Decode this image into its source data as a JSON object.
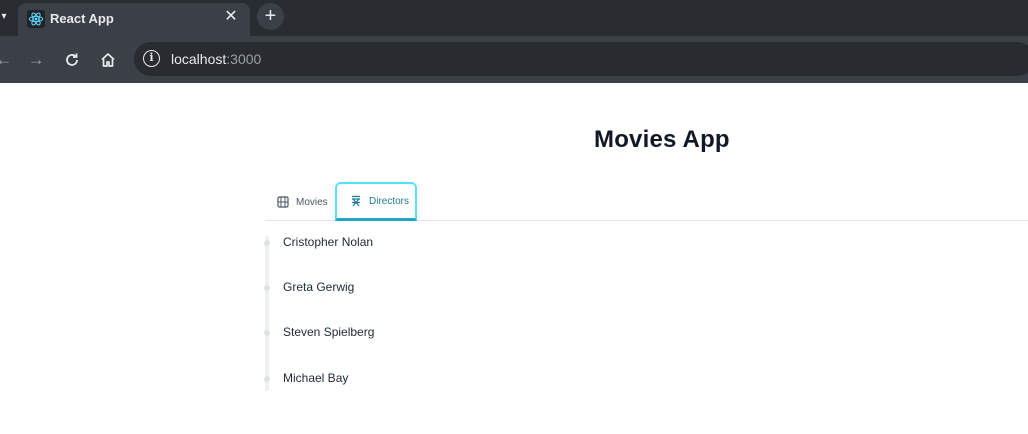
{
  "browser": {
    "tab_title": "React App",
    "url_host": "localhost",
    "url_port": ":3000"
  },
  "app": {
    "title": "Movies App",
    "tabs": [
      {
        "label": "Movies",
        "icon": "film-icon",
        "active": false
      },
      {
        "label": "Directors",
        "icon": "director-chair-icon",
        "active": true
      }
    ],
    "directors": [
      "Cristopher Nolan",
      "Greta Gerwig",
      "Steven Spielberg",
      "Michael Bay"
    ]
  },
  "colors": {
    "active_tab_text": "#1f7a96",
    "active_tab_outline": "#5be1f5",
    "title_text": "#111827"
  }
}
